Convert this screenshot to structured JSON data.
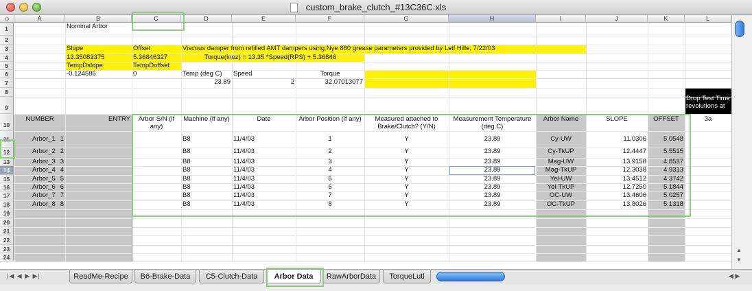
{
  "window": {
    "title": "custom_brake_clutch_#13C36C.xls"
  },
  "colors": {
    "yellow": "#fff200",
    "gray": "#c8c8c8",
    "black": "#000000",
    "highlight": "#8ad07a"
  },
  "columns": [
    "A",
    "B",
    "C",
    "D",
    "E",
    "F",
    "G",
    "H",
    "I",
    "J",
    "K",
    "L"
  ],
  "rows": [
    "1",
    "2",
    "3",
    "4",
    "5",
    "6",
    "7",
    "8",
    "9",
    "10",
    "11",
    "12",
    "13",
    "14",
    "15",
    "16",
    "17",
    "18",
    "19",
    "20",
    "21",
    "22",
    "23",
    "24"
  ],
  "cells": {
    "b1": "Nominal Arbor",
    "b3": "Slope",
    "c3": "Offset",
    "d3": "Viscous damper from refilled AMT dampers using Nye 880 grease  parameters provided by Leif Hille, 7/22/03",
    "b4": "13.35083375",
    "c4": "5.36846327",
    "d4": "Torque(inoz) = 13.35 *Speed(RPS) + 5.36846",
    "b5": "TempDslope",
    "c5": "TempDoffset",
    "b6": "-0.124585",
    "c6": "0",
    "d6": "Temp (deg C)",
    "e6": "Speed",
    "f6": "Torque",
    "d7": "23.89",
    "e7": "2",
    "f7": "32.07013077",
    "l8": "Drop Test Time revolutions at",
    "a10": "NUMBER",
    "b10": "ENTRY",
    "c10": "Arbor S/N (if any)",
    "d10": "Machine (if any)",
    "e10": "Date",
    "f10": "Arbor Position (if any)",
    "g10": "Measured attached to Brake/Clutch? (Y/N)",
    "h10": "Measurement Temperature (deg C)",
    "i10": "Arbor Name",
    "j10": "SLOPE",
    "k10": "OFFSET",
    "l10": "3a"
  },
  "data_rows": [
    {
      "number": "1",
      "entry": "Arbor_1",
      "machine": "B8",
      "date": "11/4/03",
      "position": "1",
      "attached": "Y",
      "temp": "23.89",
      "name": "Cy-UW",
      "slope": "11.0306",
      "offset": "5.0548"
    },
    {
      "number": "2",
      "entry": "Arbor_2",
      "machine": "B8",
      "date": "11/4/03",
      "position": "2",
      "attached": "Y",
      "temp": "23.89",
      "name": "Cy-TkUP",
      "slope": "12.4447",
      "offset": "5.5515"
    },
    {
      "number": "3",
      "entry": "Arbor_3",
      "machine": "B8",
      "date": "11/4/03",
      "position": "3",
      "attached": "Y",
      "temp": "23.89",
      "name": "Mag-UW",
      "slope": "13.9158",
      "offset": "4.8537"
    },
    {
      "number": "4",
      "entry": "Arbor_4",
      "machine": "B8",
      "date": "11/4/03",
      "position": "4",
      "attached": "Y",
      "temp": "23.89",
      "name": "Mag-TkUP",
      "slope": "12.3038",
      "offset": "4.9313"
    },
    {
      "number": "5",
      "entry": "Arbor_5",
      "machine": "B8",
      "date": "11/4/03",
      "position": "5",
      "attached": "Y",
      "temp": "23.89",
      "name": "Yel-UW",
      "slope": "13.4512",
      "offset": "4.3742"
    },
    {
      "number": "6",
      "entry": "Arbor_6",
      "machine": "B8",
      "date": "11/4/03",
      "position": "6",
      "attached": "Y",
      "temp": "23.89",
      "name": "Yel-TkUP",
      "slope": "12.7250",
      "offset": "5.1844"
    },
    {
      "number": "7",
      "entry": "Arbor_7",
      "machine": "B8",
      "date": "11/4/03",
      "position": "7",
      "attached": "Y",
      "temp": "23.89",
      "name": "OC-UW",
      "slope": "13.4606",
      "offset": "5.0257"
    },
    {
      "number": "8",
      "entry": "Arbor_8",
      "machine": "B8",
      "date": "11/4/03",
      "position": "8",
      "attached": "Y",
      "temp": "23.89",
      "name": "OC-TkUP",
      "slope": "13.8026",
      "offset": "5.1318"
    }
  ],
  "tabs": [
    "ReadMe-Recipe",
    "B6-Brake-Data",
    "C5-Clutch-Data",
    "Arbor Data",
    "RawArborData",
    "TorqueLutl"
  ],
  "active_tab": "Arbor Data",
  "selected": {
    "column": "H",
    "row": "14"
  },
  "icons": {
    "close": "close-light-icon",
    "minimize": "minimize-light-icon",
    "zoom": "zoom-light-icon",
    "document": "document-icon",
    "tab_nav": "tab-nav-arrows-icon"
  }
}
